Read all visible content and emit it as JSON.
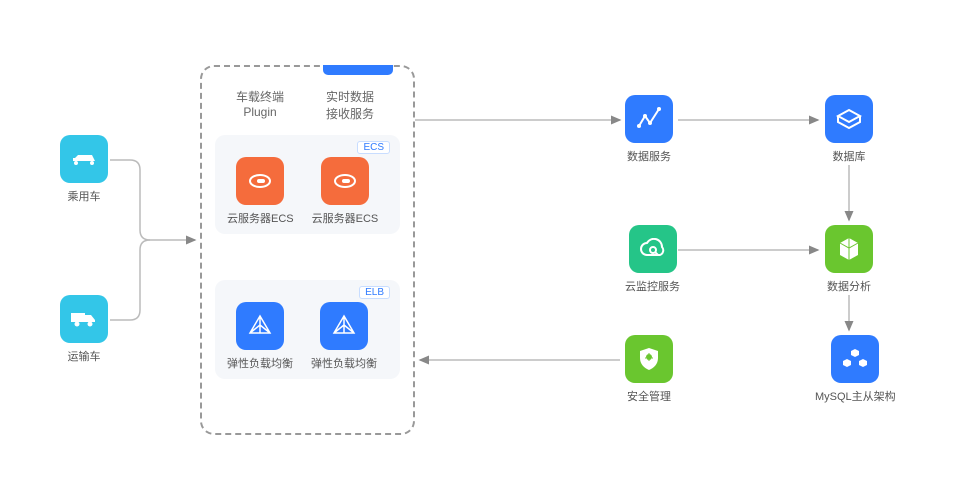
{
  "left": {
    "car": "乘用车",
    "truck": "运输车"
  },
  "center": {
    "title1": "车载终端",
    "title1b": "Plugin",
    "title2": "实时数据",
    "title2b": "接收服务",
    "ecsBadge": "ECS",
    "ecs1": "云服务器ECS",
    "ecs2": "云服务器ECS",
    "elbBadge": "ELB",
    "elb1": "弹性负载均衡",
    "elb2": "弹性负载均衡"
  },
  "right": {
    "r1": "数据服务",
    "r2": "数据库",
    "ces": "云监控服务",
    "mid": "数据分析",
    "sec": "安全管理",
    "bottom": "MySQL主从架构"
  }
}
